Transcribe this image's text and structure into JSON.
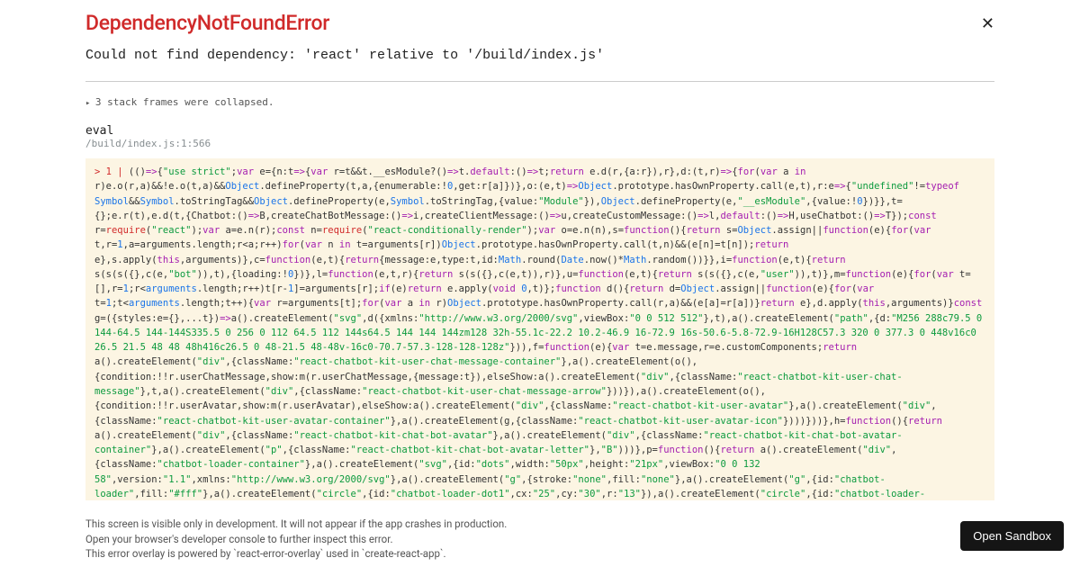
{
  "error": {
    "title": "DependencyNotFoundError",
    "message": "Could not find dependency: 'react' relative to '/build/index.js'",
    "collapsed_frames": "3 stack frames were collapsed.",
    "frame_name": "eval",
    "frame_location": "/build/index.js:1:566"
  },
  "footer": {
    "line1": "This screen is visible only in development. It will not appear if the app crashes in production.",
    "line2": "Open your browser's developer console to further inspect this error.",
    "line3": "This error overlay is powered by `react-error-overlay` used in `create-react-app`."
  },
  "sandbox_button": "Open Sandbox"
}
